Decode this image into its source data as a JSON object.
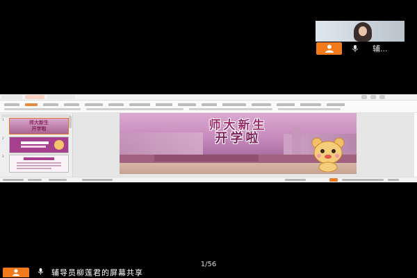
{
  "participant": {
    "name": "辅..."
  },
  "slide": {
    "title_line1": "师大新生",
    "title_line2": "开学啦",
    "thumb1_line1": "师大新生",
    "thumb1_line2": "开学啦"
  },
  "pager": {
    "text": "1/56"
  },
  "share_banner": {
    "text": "辅导员柳莲君的屏幕共享"
  },
  "colors": {
    "accent": "#f27a1a",
    "slide_title": "#9a2d6a"
  }
}
